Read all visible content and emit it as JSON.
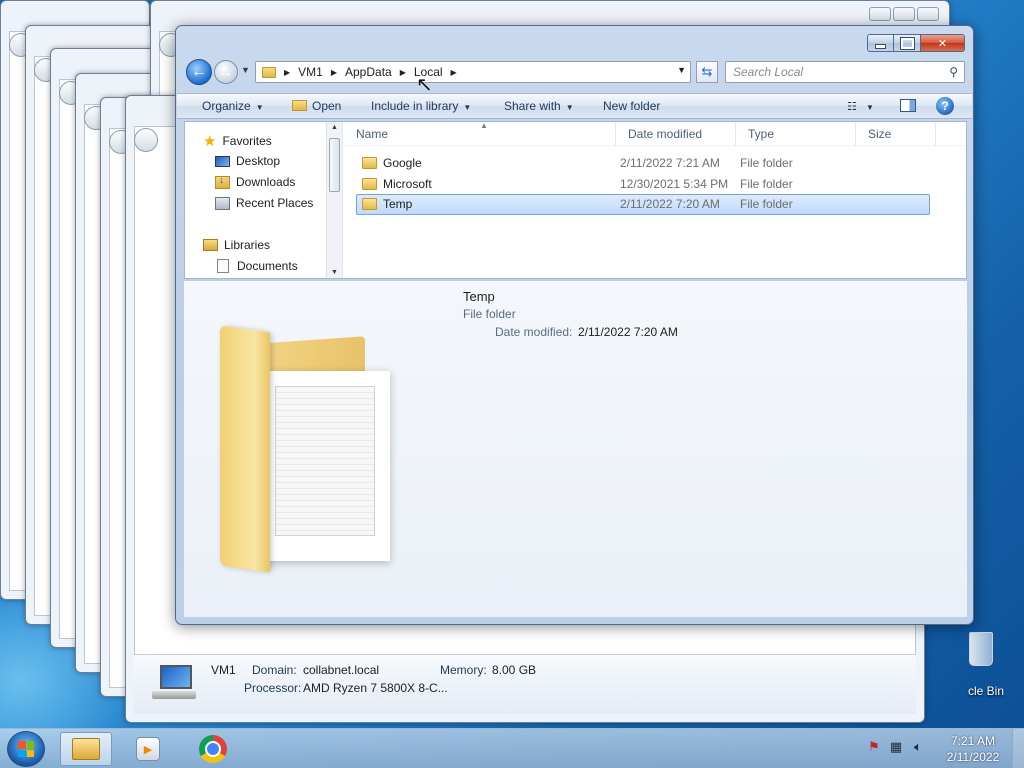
{
  "window": {
    "breadcrumb": [
      "VM1",
      "AppData",
      "Local"
    ],
    "search_placeholder": "Search Local"
  },
  "toolbar": {
    "organize": "Organize",
    "open": "Open",
    "include_in_library": "Include in library",
    "share_with": "Share with",
    "new_folder": "New folder"
  },
  "nav": {
    "favorites": "Favorites",
    "desktop": "Desktop",
    "downloads": "Downloads",
    "recent_places": "Recent Places",
    "libraries": "Libraries",
    "documents": "Documents"
  },
  "columns": {
    "name": "Name",
    "date_modified": "Date modified",
    "type": "Type",
    "size": "Size"
  },
  "files": [
    {
      "name": "Google",
      "date": "2/11/2022 7:21 AM",
      "type": "File folder"
    },
    {
      "name": "Microsoft",
      "date": "12/30/2021 5:34 PM",
      "type": "File folder"
    },
    {
      "name": "Temp",
      "date": "2/11/2022 7:20 AM",
      "type": "File folder",
      "selected": true
    }
  ],
  "details": {
    "name": "Temp",
    "type": "File folder",
    "modified_label": "Date modified:",
    "modified_value": "2/11/2022 7:20 AM"
  },
  "sysinfo": {
    "computer_name": "VM1",
    "domain_label": "Domain:",
    "domain_value": "collabnet.local",
    "memory_label": "Memory:",
    "memory_value": "8.00 GB",
    "processor_label": "Processor:",
    "processor_value": "AMD Ryzen 7 5800X 8-C..."
  },
  "desktop": {
    "recycle_bin_label": "cle Bin"
  },
  "taskbar": {
    "time": "7:21 AM",
    "date": "2/11/2022"
  }
}
